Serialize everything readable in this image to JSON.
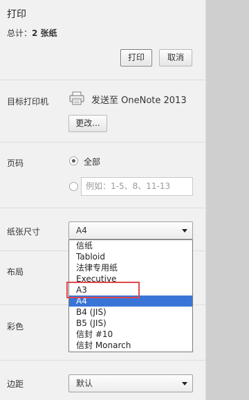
{
  "header": {
    "title": "打印",
    "total_prefix": "总计：",
    "total_value": "2 张纸",
    "print_button": "打印",
    "cancel_button": "取消"
  },
  "destination": {
    "label": "目标打印机",
    "printer_name": "发送至 OneNote 2013",
    "change_button": "更改..."
  },
  "pages": {
    "label": "页码",
    "all_option": "全部",
    "custom_placeholder": "例如：1-5、8、11-13"
  },
  "paper_size": {
    "label": "纸张尺寸",
    "selected": "A4",
    "options": [
      "信纸",
      "Tabloid",
      "法律专用纸",
      "Executive",
      "A3",
      "A4",
      "B4 (JIS)",
      "B5 (JIS)",
      "信封 #10",
      "信封 Monarch"
    ]
  },
  "layout": {
    "label": "布局"
  },
  "color": {
    "label": "彩色"
  },
  "margins": {
    "label": "边距",
    "selected": "默认"
  },
  "colors": {
    "selected_option_bg": "#3875d7",
    "highlight_border": "#e0474c",
    "preview_bg": "#cfcfcf"
  }
}
